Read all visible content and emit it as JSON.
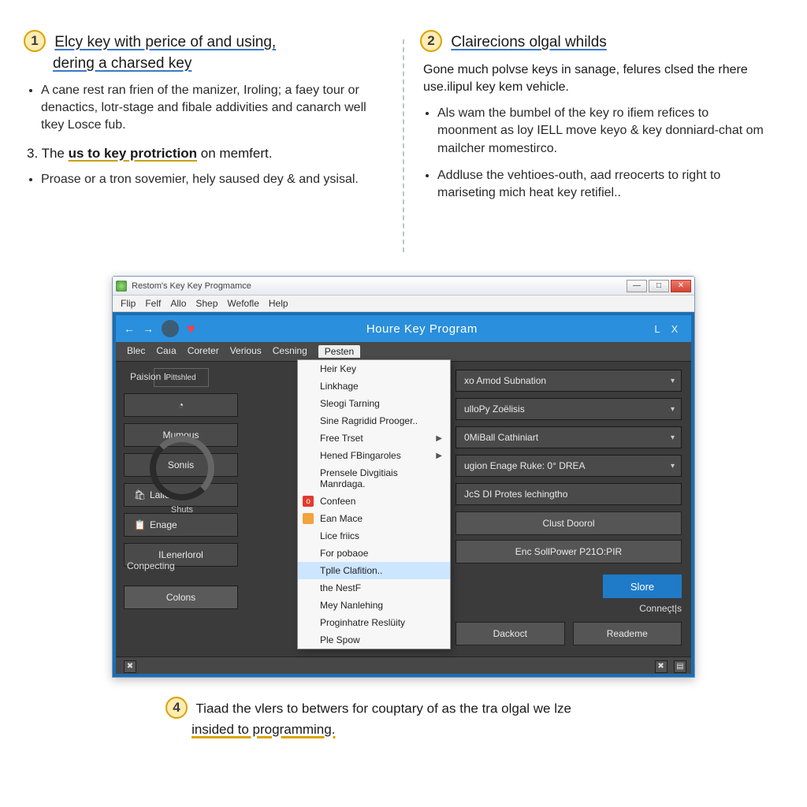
{
  "step1": {
    "number": "1",
    "title_a": "Elcy key with perice of and using,",
    "title_b": "dering a charsed key",
    "bullet1": "A cane rest ran frien of the manizer, Iroling; a faey tour or denactics, lotr-stage and fibale addivities and canarch well tkey Losce fub.",
    "sub3": "3. The us to key protriction on memfert.",
    "sub3_bold": "us to key protriction",
    "bullet2": "Proase or a tron sovemier, hely saused dey & and ysisal."
  },
  "step2": {
    "number": "2",
    "title": "Clairecions olgal whilds",
    "para": "Gone much polvse keys in sanage, felures clsed the rhere use.ilipul key kem vehicle.",
    "bullet1": "Als wam the bumbel of the key ro ifiem refices to moonment as loy IELL move keyo & key donniard-chat om mailcher momestirco.",
    "bullet2": "Addluse the vehtioes-outh, aad rreocerts to right to mariseting mich heat key retifiel.."
  },
  "step4": {
    "number": "4",
    "text_a": "Tiaad the vlers to betwers for couptary of as the tra olgal we lze",
    "text_b": "insided to programming."
  },
  "window": {
    "title": "Restom's Key Key Progmamce",
    "menus": [
      "Flip",
      "Felf",
      "Allo",
      "Shep",
      "Wefofle",
      "Help"
    ],
    "controls": {
      "min": "—",
      "max": "□",
      "close": "✕"
    }
  },
  "app": {
    "header_title": "Houre Key Program",
    "header_L": "L",
    "header_X": "X",
    "tabs": [
      "Blec",
      "Caıa",
      "Coreter",
      "Verious",
      "Cesning",
      "Pesten"
    ],
    "sidebar": {
      "pill": "Pittshled",
      "items": [
        "Mumous",
        "Sonıis",
        "Lalles",
        "Enage",
        "ILenerlorol"
      ],
      "colons": "Colons"
    },
    "section_label": "Paision I",
    "shuts": "Shuts",
    "connecting": "Conpecting",
    "popup_items": [
      {
        "label": "Heir Key"
      },
      {
        "label": "Linkhage"
      },
      {
        "label": "Sleogi Tarning"
      },
      {
        "label": "Sine Ragridid Prooger.."
      },
      {
        "label": "Free Trset",
        "arrow": true
      },
      {
        "label": "Hened FBingaroles",
        "arrow": true
      },
      {
        "label": "Prensele Divgitiais Manrdaga."
      },
      {
        "label": "Confeen",
        "icon": "red"
      },
      {
        "label": "Ean Mace",
        "icon": "orn"
      },
      {
        "label": "Lice friics"
      },
      {
        "label": "For pobaoe"
      },
      {
        "label": "Tplle Clafition..",
        "hl": true
      },
      {
        "label": "the NestF"
      },
      {
        "label": "Mey Nanlehing"
      },
      {
        "label": "Proginhatre Reslüity"
      },
      {
        "label": "Ple Spow"
      }
    ],
    "dropdowns": [
      "xo Amod Subnation",
      "ulloPy Zoëlisis",
      "0MiBall Cathiniart",
      "ugion Enage Ruke: 0° DREA",
      "JcS DI Protes lechingtho"
    ],
    "flat_buttons": [
      "Clust Doorol",
      "Enc SollPower P21O:PIR"
    ],
    "store": "Slore",
    "connects": "Conneçt|s",
    "footer_buttons": [
      "Dackoct",
      "Reademe"
    ]
  }
}
